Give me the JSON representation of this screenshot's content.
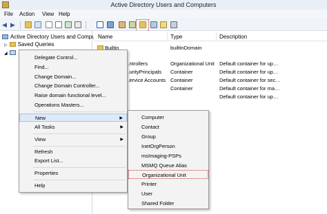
{
  "window": {
    "title": "Active Directory Users and Computers"
  },
  "menu": [
    "File",
    "Action",
    "View",
    "Help"
  ],
  "toolbar": {
    "icons": [
      "back-icon",
      "forward-icon",
      "up-icon",
      "console-tree-icon",
      "copy-icon",
      "properties-icon",
      "refresh-icon",
      "export-icon",
      "help-icon",
      "new-user-icon",
      "new-group-icon",
      "new-ou-icon",
      "filter-icon",
      "find-icon",
      "add-to-group-icon"
    ]
  },
  "tree": {
    "root": "Active Directory Users and Comput",
    "saved_queries": "Saved Queries"
  },
  "list": {
    "columns": {
      "name": "Name",
      "type": "Type",
      "description": "Description"
    },
    "rows": [
      {
        "name": "Builtin",
        "type": "builtinDomain",
        "description": ""
      },
      {
        "name": "…ntrollers",
        "type": "Organizational Unit",
        "description": "Default container for up…"
      },
      {
        "name": "…urityPrincipals",
        "type": "Container",
        "description": "Default container for up…"
      },
      {
        "name": "…ervice Accounts",
        "type": "Container",
        "description": "Default container for sec…"
      },
      {
        "name": "",
        "type": "Container",
        "description": "Default container for ma…"
      },
      {
        "name": "",
        "type": "",
        "description": "Default container for up…"
      }
    ]
  },
  "context_menu": {
    "items": [
      "Delegate Control...",
      "Find...",
      "Change Domain...",
      "Change Domain Controller...",
      "Raise domain functional level...",
      "Operations Masters...",
      "New",
      "All Tasks",
      "View",
      "Refresh",
      "Export List...",
      "Properties",
      "Help"
    ]
  },
  "new_submenu": {
    "items": [
      "Computer",
      "Contact",
      "Group",
      "InetOrgPerson",
      "msImaging-PSPs",
      "MSMQ Queue Alias",
      "Organizational Unit",
      "Printer",
      "User",
      "Shared Folder"
    ]
  },
  "colors": {
    "highlight": "#dce9f7",
    "annotation": "#c0392b"
  }
}
